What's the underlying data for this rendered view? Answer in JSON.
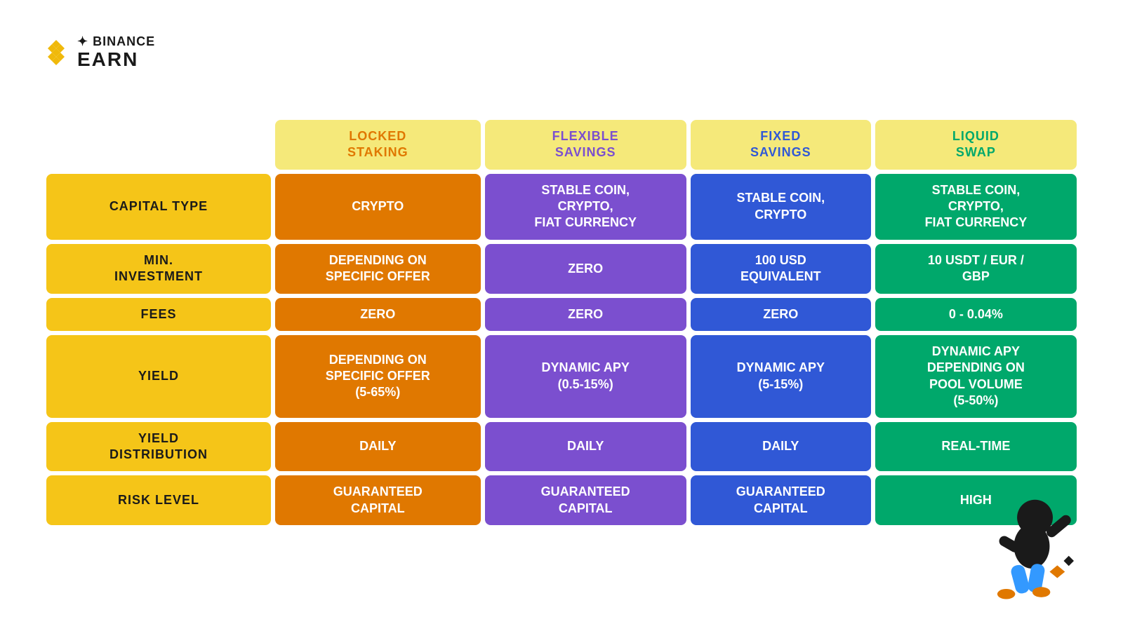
{
  "logo": {
    "binance": "✦ BINANCE",
    "earn": "EARN"
  },
  "columns": {
    "locked": {
      "line1": "LOCKED",
      "line2": "STAKING"
    },
    "flexible": {
      "line1": "FLEXIBLE",
      "line2": "SAVINGS"
    },
    "fixed": {
      "line1": "FIXED",
      "line2": "SAVINGS"
    },
    "liquid": {
      "line1": "LIQUID",
      "line2": "SWAP"
    }
  },
  "rows": {
    "capital_type": {
      "label_line1": "CAPITAL TYPE",
      "label_line2": "",
      "locked": "CRYPTO",
      "flexible": "STABLE COIN,\nCRYPTO,\nFIAT CURRENCY",
      "fixed": "STABLE COIN,\nCRYPTO",
      "liquid": "STABLE COIN,\nCRYPTO,\nFIAT CURRENCY"
    },
    "min_investment": {
      "label_line1": "MIN.",
      "label_line2": "INVESTMENT",
      "locked": "DEPENDING ON\nSPECIFIC OFFER",
      "flexible": "ZERO",
      "fixed": "100 USD\nEQUIVALENT",
      "liquid": "10 USDT / EUR /\nGBP"
    },
    "fees": {
      "label_line1": "FEES",
      "label_line2": "",
      "locked": "ZERO",
      "flexible": "ZERO",
      "fixed": "ZERO",
      "liquid": "0 - 0.04%"
    },
    "yield": {
      "label_line1": "YIELD",
      "label_line2": "",
      "locked": "DEPENDING ON\nSPECIFIC OFFER\n(5-65%)",
      "flexible": "DYNAMIC APY\n(0.5-15%)",
      "fixed": "DYNAMIC APY\n(5-15%)",
      "liquid": "DYNAMIC APY\nDEPENDING ON\nPOOL VOLUME\n(5-50%)"
    },
    "yield_distribution": {
      "label_line1": "YIELD",
      "label_line2": "DISTRIBUTION",
      "locked": "DAILY",
      "flexible": "DAILY",
      "fixed": "DAILY",
      "liquid": "REAL-TIME"
    },
    "risk_level": {
      "label_line1": "RISK LEVEL",
      "label_line2": "",
      "locked": "GUARANTEED\nCAPITAL",
      "flexible": "GUARANTEED\nCAPITAL",
      "fixed": "GUARANTEED\nCAPITAL",
      "liquid": "HIGH"
    }
  }
}
